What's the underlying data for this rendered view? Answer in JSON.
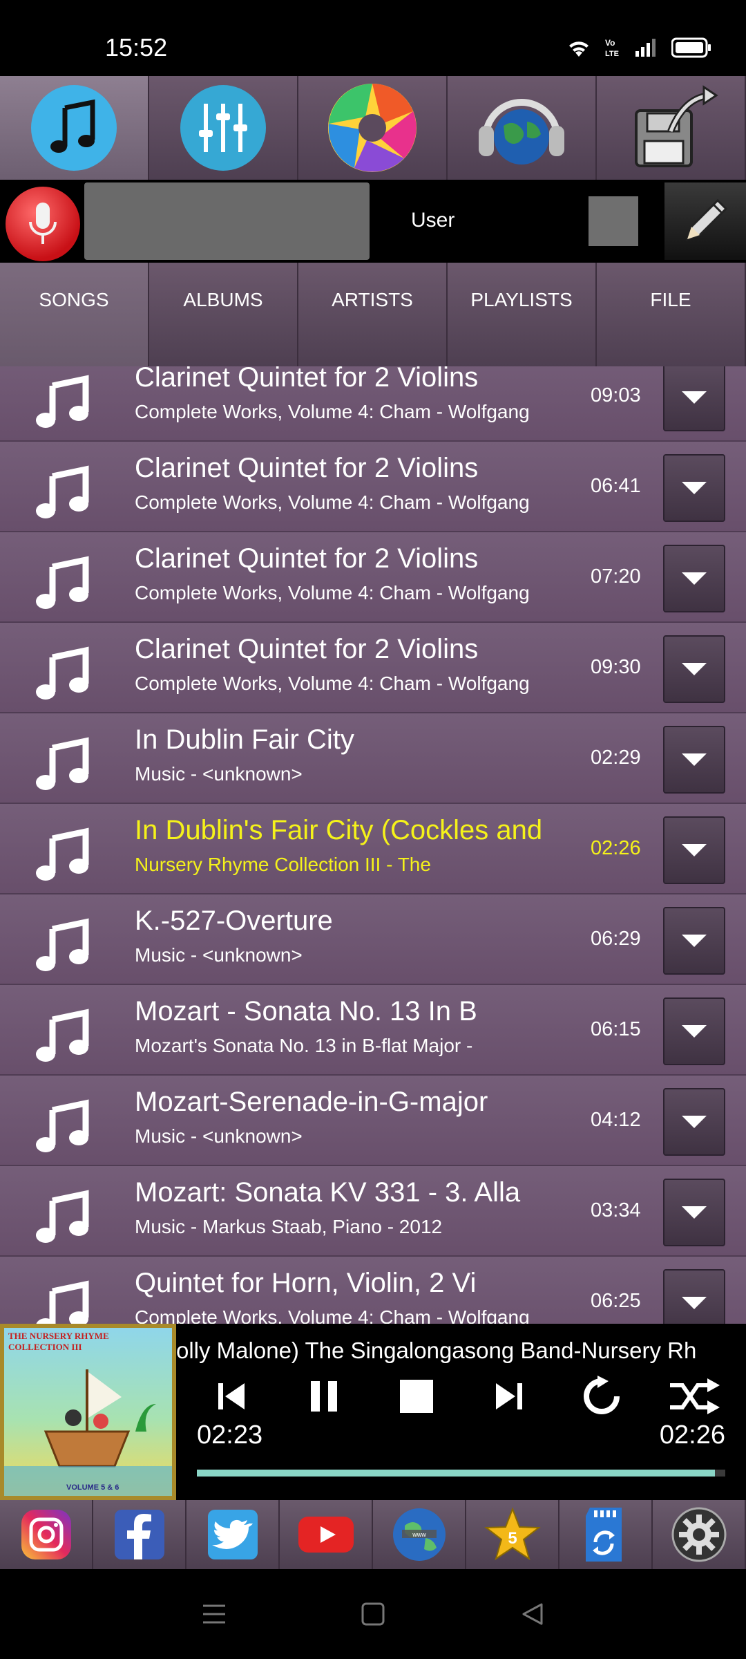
{
  "status_bar": {
    "time": "15:52",
    "volte_label": "Vo\nLTE"
  },
  "toolbar": {
    "buttons": [
      "music-icon",
      "equalizer-icon",
      "aperture-icon",
      "headphones-globe-icon",
      "save-export-icon"
    ]
  },
  "user_row": {
    "user_label": "User"
  },
  "tabs": [
    {
      "label": "SONGS"
    },
    {
      "label": "ALBUMS"
    },
    {
      "label": "ARTISTS"
    },
    {
      "label": "PLAYLISTS"
    },
    {
      "label": "FILE"
    }
  ],
  "songs": [
    {
      "title": "Clarinet Quintet for 2 Violins",
      "subtitle": "Complete Works, Volume 4: Cham - Wolfgang",
      "duration": "09:03"
    },
    {
      "title": "Clarinet Quintet for 2 Violins",
      "subtitle": "Complete Works, Volume 4: Cham - Wolfgang",
      "duration": "06:41"
    },
    {
      "title": "Clarinet Quintet for 2 Violins",
      "subtitle": "Complete Works, Volume 4: Cham - Wolfgang",
      "duration": "07:20"
    },
    {
      "title": "Clarinet Quintet for 2 Violins",
      "subtitle": "Complete Works, Volume 4: Cham - Wolfgang",
      "duration": "09:30"
    },
    {
      "title": "In Dublin Fair City",
      "subtitle": "Music - <unknown>",
      "duration": "02:29"
    },
    {
      "title": "In Dublin's Fair City (Cockles and",
      "subtitle": "Nursery Rhyme Collection III - The",
      "duration": "02:26"
    },
    {
      "title": "K.-527-Overture",
      "subtitle": "Music - <unknown>",
      "duration": "06:29"
    },
    {
      "title": "Mozart - Sonata No. 13 In B",
      "subtitle": "Mozart's Sonata No. 13 in B-flat Major -",
      "duration": "06:15"
    },
    {
      "title": "Mozart-Serenade-in-G-major",
      "subtitle": "Music - <unknown>",
      "duration": "04:12"
    },
    {
      "title": "Mozart: Sonata KV 331 - 3. Alla",
      "subtitle": "Music - Markus Staab, Piano - 2012",
      "duration": "03:34"
    },
    {
      "title": "Quintet for Horn, Violin, 2 Vi",
      "subtitle": "Complete Works, Volume 4: Cham - Wolfgang",
      "duration": "06:25"
    }
  ],
  "player": {
    "now_playing": "olly Malone) The Singalongasong Band-Nursery Rh",
    "elapsed": "02:23",
    "duration": "02:26",
    "progress_percent": 98,
    "album_art": {
      "title": "THE NURSERY RHYME COLLECTION III",
      "volume": "VOLUME 5 & 6"
    }
  },
  "social": [
    "instagram-icon",
    "facebook-icon",
    "twitter-icon",
    "youtube-icon",
    "web-globe-icon",
    "star-icon",
    "sd-card-sync-icon",
    "settings-gear-icon"
  ],
  "colors": {
    "accent_highlight": "#f5f21a",
    "list_background": "#6c5570",
    "progress": "#8ad5c6"
  }
}
